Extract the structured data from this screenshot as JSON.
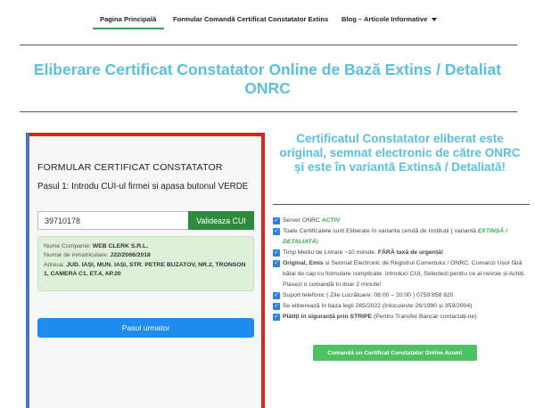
{
  "nav": {
    "items": [
      {
        "label": "Pagina Principală"
      },
      {
        "label": "Formular Comandă Certificat Constatator Extins"
      },
      {
        "label": "Blog – Articole Informative"
      }
    ]
  },
  "header": {
    "title": "Eliberare Certificat Constatator Online de Bază Extins / Detaliat ONRC"
  },
  "form": {
    "title": "FORMULAR CERTIFICAT CONSTATATOR",
    "step": "Pasul 1: Introdu CUI-ul firmei si apasa butonul VERDE",
    "cui_value": "39710178",
    "validate_label": "Valideaza CUI",
    "company": {
      "name_label": "Nume Companie:",
      "name_value": "WEB CLERK S.R.L.",
      "reg_label": "Numar de inmatriculare:",
      "reg_value": "J22/2066/2018",
      "address_label": "Adresa:",
      "address_value": "JUD. IAȘI, MUN. IAȘI, STR. PETRE BUZATOV, NR.2, TRONSON 1, CAMERA C1, ET.4, AP.20"
    },
    "next_label": "Pasul urmator"
  },
  "right": {
    "title": "Certificatul Constatator eliberat este original, semnat electronic de către ONRC și este în variantă Extinsă / Detaliată!",
    "features": [
      {
        "a": "Server ONRC ",
        "b": "ACTIV",
        "c": ""
      },
      {
        "a": "Toate Certificatele sunt Eliberate în varianta cerută de Instituții ( variantă ",
        "b": "EXTINSĂ / DETALIATĂ",
        "c": ")"
      },
      {
        "a": "Timp Mediu de Livrare ~10 minute. ",
        "b": "FĂRĂ taxă de urgență!",
        "c": ""
      },
      {
        "a": "Original",
        "b": ", Emis",
        "c": " și Semnat Electronic de Registrul Comerțului / ONRC. Comanzi Ușor fără bătai de cap cu formulare complicate. Introduci CUI, Selectezi pentru ce ai nevoie și Achiți. Plasezi o comandă în doar 2 minute!"
      },
      {
        "a": "Suport telefonic ( Zile Lucrătoare: 08:00 – 20:00 ) 0759 858 820",
        "b": "",
        "c": ""
      },
      {
        "a": "Se eliberează în baza legii 265/2022 (înlocuiește 26/1990 și 359/2004)",
        "b": "",
        "c": ""
      },
      {
        "a": "Plătiți în siguranță prin STRIPE",
        "b": " (Pentru Transfer Bancar contactați-ne)",
        "c": ""
      }
    ],
    "order_label": "Comandă un Certificat Constatator Online Acum!"
  }
}
